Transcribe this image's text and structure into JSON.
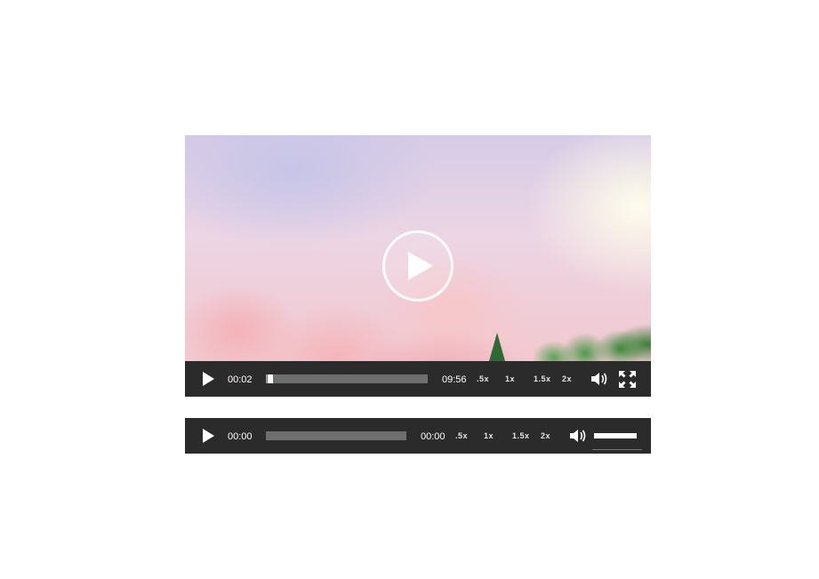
{
  "video_player": {
    "current_time": "00:02",
    "duration": "09:56",
    "progress": 0.005,
    "speeds": [
      ".5x",
      "1x",
      "1.5x",
      "2x"
    ],
    "icons": {
      "big_play": "play-circle-icon",
      "play": "play-icon",
      "volume": "volume-icon",
      "fullscreen": "fullscreen-icon"
    }
  },
  "audio_player": {
    "current_time": "00:00",
    "duration": "00:00",
    "progress": 0,
    "volume": 0.8,
    "speeds": [
      ".5x",
      "1x",
      "1.5x",
      "2x"
    ],
    "icons": {
      "play": "play-icon",
      "volume": "volume-icon"
    }
  },
  "colors": {
    "control_bar": "#2b2b2b",
    "rail": "#6e6e6e",
    "text": "#ffffff"
  }
}
